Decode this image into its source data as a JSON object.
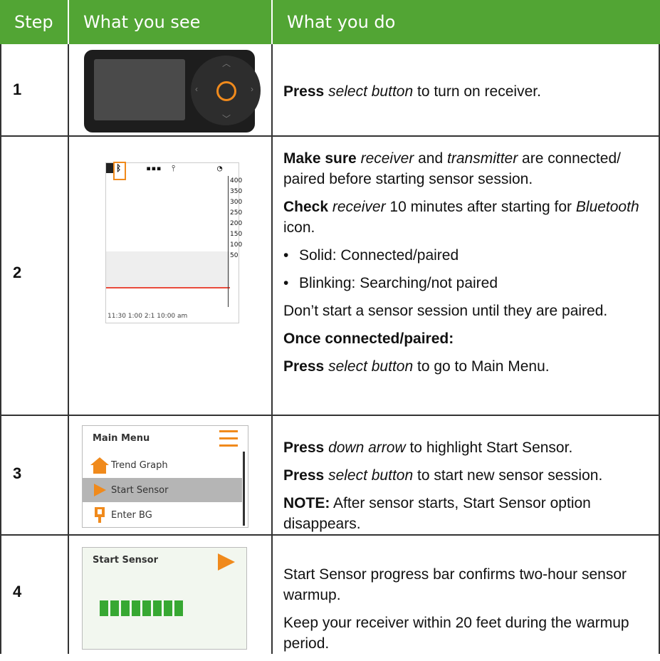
{
  "header": {
    "step": "Step",
    "see": "What you see",
    "do": "What you do"
  },
  "colors": {
    "header_bg": "#52a534",
    "accent": "#f08a1c",
    "progress": "#37a832",
    "low_line": "#e94b3c"
  },
  "rows": [
    {
      "step": "1",
      "image": "receiver-device-icon",
      "press": "Press",
      "press_obj": "select button",
      "press_rest": "to turn on receiver."
    },
    {
      "step": "2",
      "image": "receiver-trend-screen",
      "screen": {
        "axis": [
          "400",
          "350",
          "300",
          "250",
          "200",
          "150",
          "100",
          "50"
        ],
        "status": "▪▪▪",
        "bottom": "11:30       1:00       2:1  10:00 am"
      },
      "make_sure": "Make sure",
      "make_sure_a": "receiver",
      "make_sure_and": "and",
      "make_sure_b": "transmitter",
      "make_sure_rest": "are connected/ paired before starting sensor session.",
      "check": "Check",
      "check_obj": "receiver",
      "check_rest": "10 minutes after starting for",
      "check_bt": "Bluetooth",
      "check_icon": "icon.",
      "bullets": [
        "Solid: Connected/paired",
        "Blinking: Searching/not paired"
      ],
      "dont": "Don’t start a sensor session until they are paired.",
      "once": "Once connected/paired:",
      "press": "Press",
      "press_obj": "select button",
      "press_rest": "to go to Main Menu."
    },
    {
      "step": "3",
      "image": "main-menu-screen",
      "menu": {
        "title": "Main Menu",
        "items": [
          "Trend Graph",
          "Start Sensor",
          "Enter BG"
        ]
      },
      "p1": "Press",
      "p1_obj": "down arrow",
      "p1_rest": "to highlight Start Sensor.",
      "p2": "Press",
      "p2_obj": "select button",
      "p2_rest": "to start new sensor session.",
      "note": "NOTE:",
      "note_rest": "After sensor starts, Start Sensor option disappears."
    },
    {
      "step": "4",
      "image": "start-sensor-screen",
      "screen_title": "Start Sensor",
      "progress_segments": 8,
      "t1": "Start Sensor progress bar confirms two-hour sensor warmup.",
      "t2": "Keep your receiver within 20 feet during the warmup period."
    }
  ]
}
